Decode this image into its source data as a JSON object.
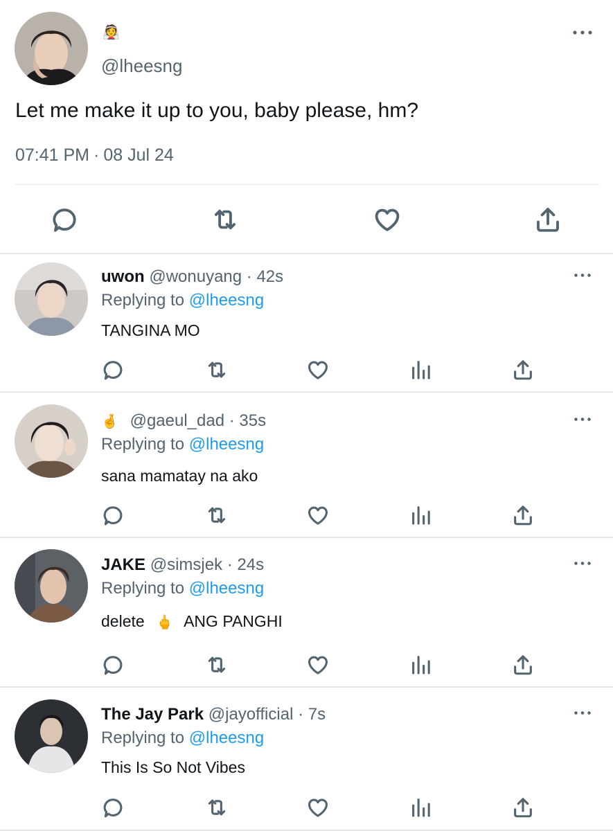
{
  "main": {
    "emoji": "👰",
    "handle": "@lheesng",
    "text": "Let me make it up to you, baby please, hm?",
    "time": "07:41 PM",
    "separator": "·",
    "date": "08 Jul 24"
  },
  "replies": [
    {
      "name": "uwon",
      "emoji": "",
      "handle": "@wonuyang",
      "separator": "·",
      "time": "42s",
      "replying_label": "Replying to",
      "replying_to": "@lheesng",
      "text": "TANGINA MO"
    },
    {
      "name": "",
      "emoji": "🤞",
      "handle": "@gaeul_dad",
      "separator": "·",
      "time": "35s",
      "replying_label": "Replying to",
      "replying_to": "@lheesng",
      "text": "sana mamatay na ako"
    },
    {
      "name": "JAKE",
      "emoji": "",
      "handle": "@simsjek",
      "separator": "·",
      "time": "24s",
      "replying_label": "Replying to",
      "replying_to": "@lheesng",
      "text_before": "delete",
      "text_emoji": "🖕",
      "text_after": "ANG PANGHI"
    },
    {
      "name": "The Jay Park",
      "emoji": "",
      "handle": "@jayofficial",
      "separator": "·",
      "time": "7s",
      "replying_label": "Replying to",
      "replying_to": "@lheesng",
      "text": "This Is So Not Vibes"
    }
  ],
  "icons": {
    "reply": "speech-bubble-icon",
    "retweet": "retweet-icon",
    "like": "heart-icon",
    "views": "bar-chart-icon",
    "share": "share-icon",
    "more": "more-dots-icon"
  },
  "colors": {
    "text": "#0f1419",
    "muted": "#536471",
    "link": "#1d9bf0",
    "divider": "#e4e7ea"
  }
}
